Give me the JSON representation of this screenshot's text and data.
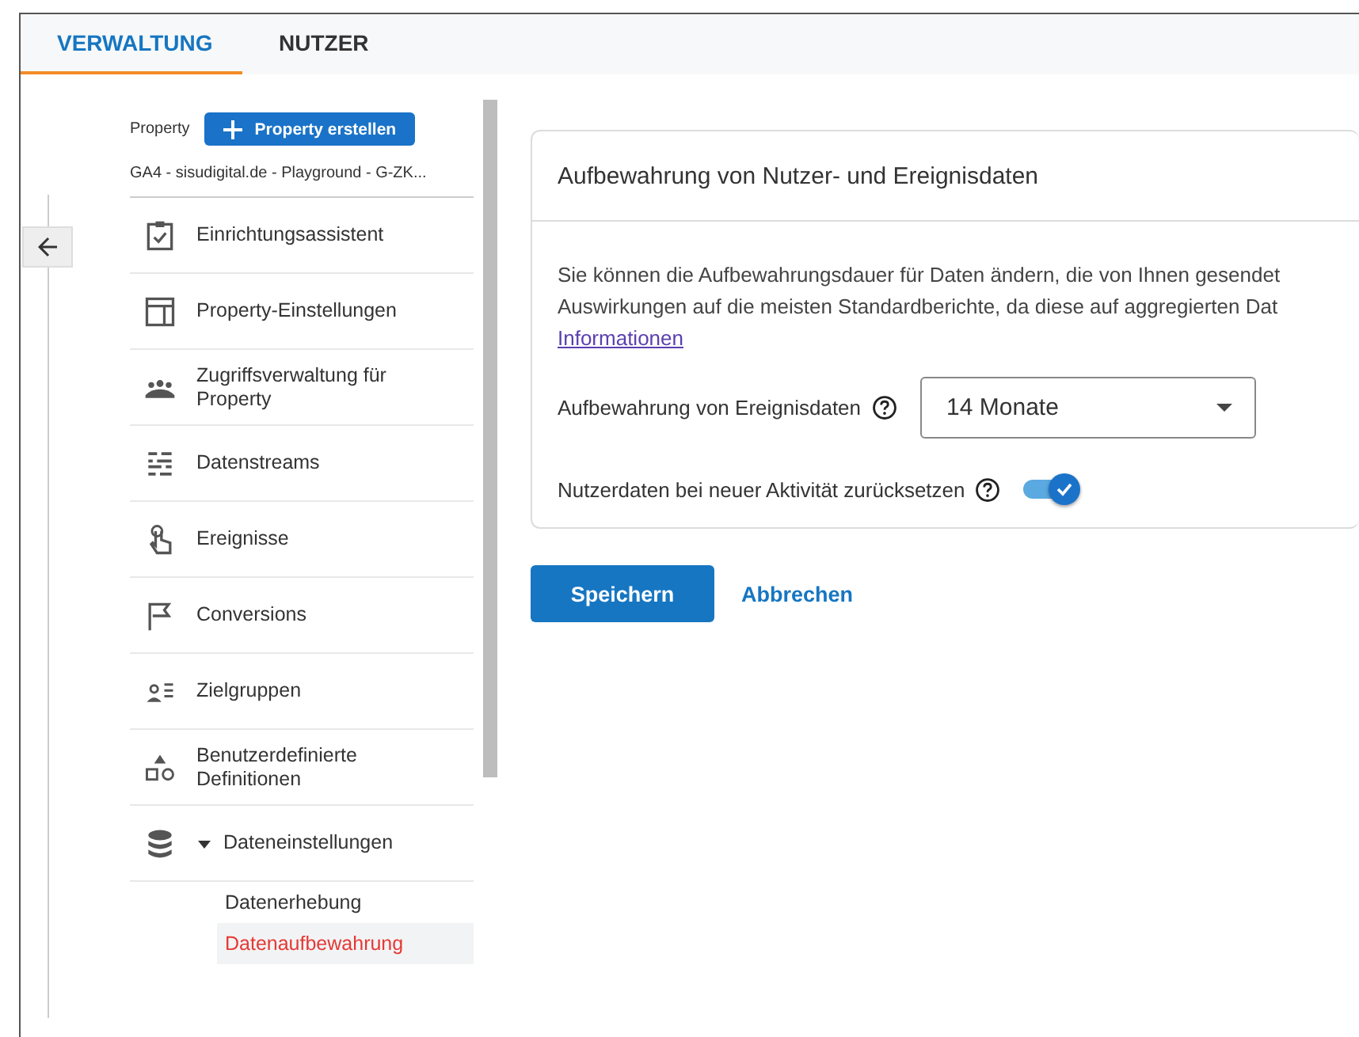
{
  "tabs": [
    {
      "label": "VERWALTUNG",
      "selected": true
    },
    {
      "label": "NUTZER",
      "selected": false
    }
  ],
  "sidebar": {
    "property_label": "Property",
    "create_button": "Property erstellen",
    "property_name": "GA4 - sisudigital.de - Playground - G-ZK...",
    "items": [
      {
        "kind": "setup",
        "label": "Einrichtungsassistent"
      },
      {
        "kind": "settings",
        "label": "Property-Einstellungen"
      },
      {
        "kind": "access",
        "label": "Zugriffsverwaltung für Property"
      },
      {
        "kind": "streams",
        "label": "Datenstreams"
      },
      {
        "kind": "events",
        "label": "Ereignisse"
      },
      {
        "kind": "conversions",
        "label": "Conversions"
      },
      {
        "kind": "audiences",
        "label": "Zielgruppen"
      },
      {
        "kind": "definitions",
        "label": "Benutzerdefinierte Definitionen"
      },
      {
        "kind": "data",
        "label": "Dateneinstellungen",
        "expanded": true,
        "children": [
          {
            "label": "Datenerhebung",
            "selected": false
          },
          {
            "label": "Datenaufbewahrung",
            "selected": true
          }
        ]
      }
    ]
  },
  "card": {
    "title": "Aufbewahrung von Nutzer- und Ereignisdaten",
    "description_lines": [
      "Sie können die Aufbewahrungsdauer für Daten ändern, die von Ihnen gesendet",
      "Auswirkungen auf die meisten Standardberichte, da diese auf aggregierten Dat"
    ],
    "link": "Informationen",
    "retention": {
      "label": "Aufbewahrung von Ereignisdaten",
      "value": "14 Monate"
    },
    "reset": {
      "label": "Nutzerdaten bei neuer Aktivität zurücksetzen",
      "on": true
    }
  },
  "buttons": {
    "save": "Speichern",
    "cancel": "Abbrechen"
  }
}
